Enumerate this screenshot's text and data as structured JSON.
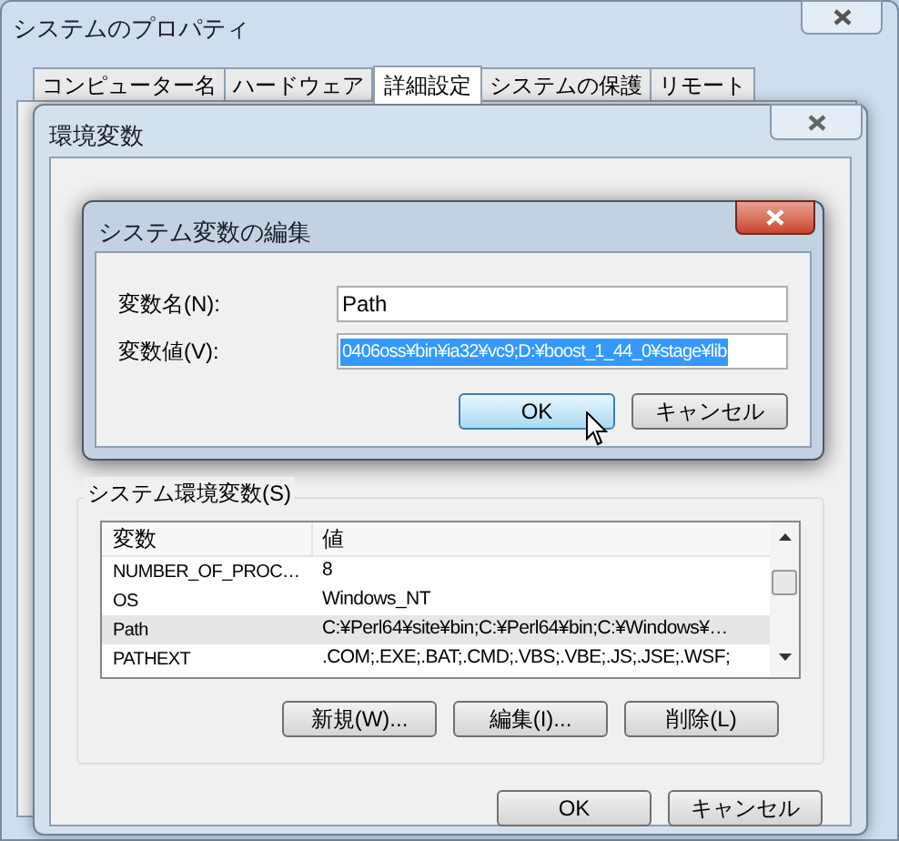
{
  "window": {
    "title": "システムのプロパティ"
  },
  "tabs": [
    {
      "label": "コンピューター名",
      "selected": false
    },
    {
      "label": "ハードウェア",
      "selected": false
    },
    {
      "label": "詳細設定",
      "selected": true
    },
    {
      "label": "システムの保護",
      "selected": false
    },
    {
      "label": "リモート",
      "selected": false
    }
  ],
  "env_dialog": {
    "title": "環境変数",
    "system_vars": {
      "label": "システム環境変数(S)",
      "columns": [
        "変数",
        "値"
      ],
      "rows": [
        {
          "name": "NUMBER_OF_PROC…",
          "value": "8",
          "selected": false
        },
        {
          "name": "OS",
          "value": "Windows_NT",
          "selected": false
        },
        {
          "name": "Path",
          "value": "C:¥Perl64¥site¥bin;C:¥Perl64¥bin;C:¥Windows¥…",
          "selected": true
        },
        {
          "name": "PATHEXT",
          "value": ".COM;.EXE;.BAT;.CMD;.VBS;.VBE;.JS;.JSE;.WSF;",
          "selected": false
        }
      ],
      "buttons": [
        "新規(W)...",
        "編集(I)...",
        "削除(L)"
      ]
    },
    "buttons": [
      "OK",
      "キャンセル"
    ]
  },
  "edit_dialog": {
    "title": "システム変数の編集",
    "fields": [
      {
        "label": "変数名(N):",
        "value": "Path",
        "text_selected": false
      },
      {
        "label": "変数値(V):",
        "value": "0406oss¥bin¥ia32¥vc9;D:¥boost_1_44_0¥stage¥lib",
        "text_selected": true
      }
    ],
    "buttons": [
      {
        "label": "OK",
        "focused": true
      },
      {
        "label": "キャンセル",
        "focused": false
      }
    ]
  }
}
